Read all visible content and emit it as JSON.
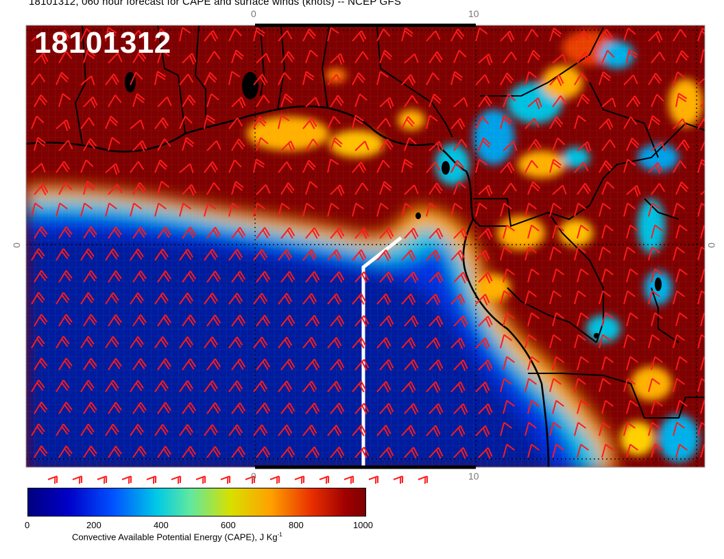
{
  "title": "18101312, 060 hour forecast for CAPE and surface winds (knots) -- NCEP GFS",
  "stamp": "18101312",
  "axis_ticks": {
    "top": [
      "0",
      "10"
    ],
    "bottom": [
      "0",
      "10"
    ],
    "left": "0",
    "right": "0"
  },
  "colorbar": {
    "labels": [
      "0",
      "200",
      "400",
      "600",
      "800",
      "1000"
    ],
    "title": "Convective Available Potential Energy (CAPE), J Kg",
    "title_sup": "-1",
    "stops": [
      "#00007f",
      "#0000c8",
      "#0050ff",
      "#00c8e8",
      "#5fe8a0",
      "#d8e000",
      "#ffa000",
      "#e83000",
      "#a00000",
      "#7f0000"
    ]
  },
  "colors": {
    "high_cape": "#7f0000",
    "low_cape": "#001a9e",
    "wind_barbs": "#ff1a1a",
    "coast": "#000000",
    "track": "#ffffff"
  }
}
